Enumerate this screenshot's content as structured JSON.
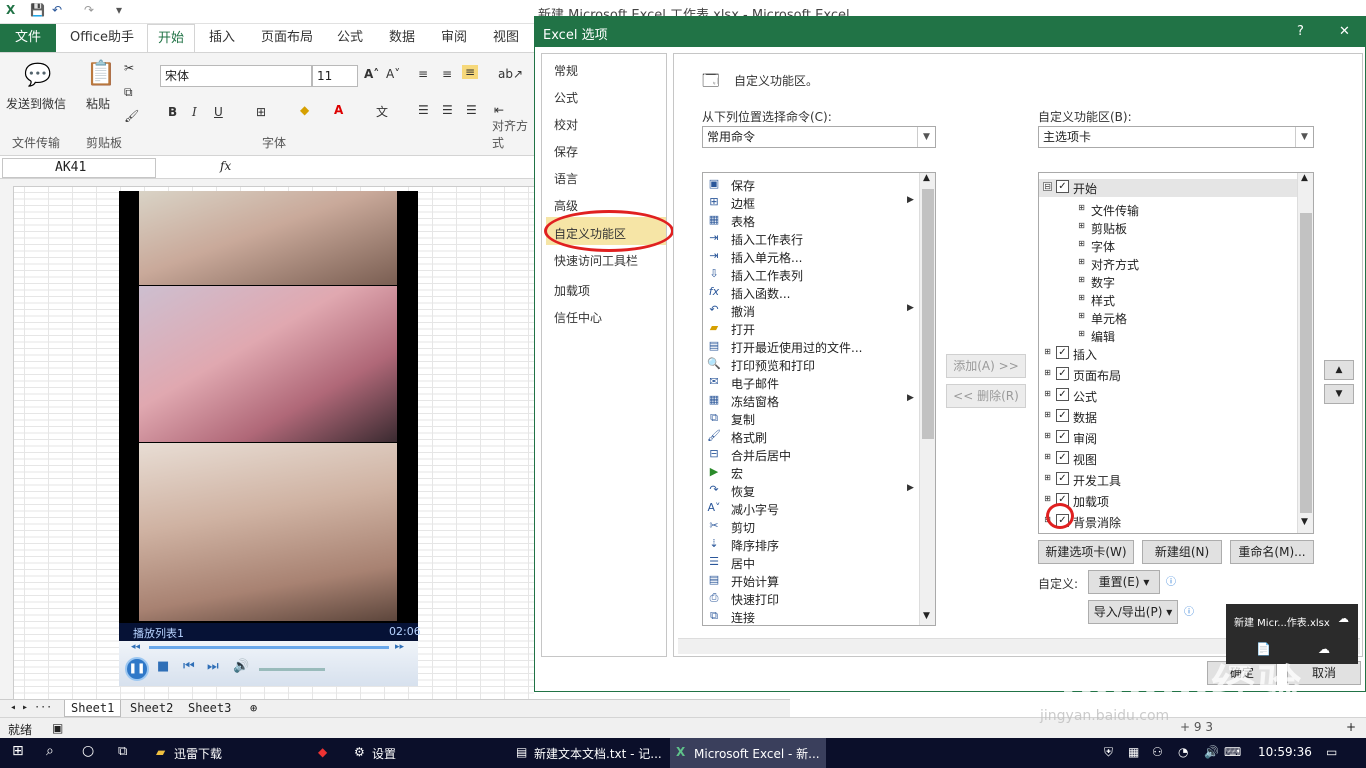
{
  "excel": {
    "title": "新建 Microsoft Excel 工作表.xlsx - Microsoft Excel",
    "tabs": [
      "文件",
      "Office助手",
      "开始",
      "插入",
      "页面布局",
      "公式",
      "数据",
      "审阅",
      "视图"
    ],
    "ribbon": {
      "send_wechat": "发送到微信",
      "paste": "粘贴",
      "font_name": "宋体",
      "font_size": "11",
      "bold": "B",
      "italic": "I",
      "underline": "U",
      "groups": [
        "文件传输",
        "剪贴板",
        "字体",
        "对齐方式"
      ]
    },
    "namebox": "AK41",
    "fx": "fx",
    "sheets": [
      "Sheet1",
      "Sheet2",
      "Sheet3"
    ],
    "status": "就绪",
    "zoom": "+",
    "time_fragment": "+ 9 3"
  },
  "player": {
    "playlist": "播放列表1",
    "time": "02:06"
  },
  "dialog": {
    "title": "Excel 选项",
    "help": "?",
    "close": "✕",
    "nav": [
      "常规",
      "公式",
      "校对",
      "保存",
      "语言",
      "高级",
      "自定义功能区",
      "快速访问工具栏",
      "加载项",
      "信任中心"
    ],
    "heading": "自定义功能区。",
    "choose_label": "从下列位置选择命令(C):",
    "choose_value": "常用命令",
    "customize_label": "自定义功能区(B):",
    "customize_value": "主选项卡",
    "commands": [
      "保存",
      "边框",
      "表格",
      "插入工作表行",
      "插入单元格...",
      "插入工作表列",
      "插入函数...",
      "撤消",
      "打开",
      "打开最近使用过的文件...",
      "打印预览和打印",
      "电子邮件",
      "冻结窗格",
      "复制",
      "格式刷",
      "合并后居中",
      "宏",
      "恢复",
      "减小字号",
      "剪切",
      "降序排序",
      "居中",
      "开始计算",
      "快速打印",
      "连接"
    ],
    "add": "添加(A) >>",
    "remove": "<< 删除(R)",
    "tree": [
      {
        "label": "开始",
        "level": 0,
        "exp": "⊟",
        "checked": true
      },
      {
        "label": "文件传输",
        "level": 1,
        "exp": "⊞",
        "checked": false
      },
      {
        "label": "剪贴板",
        "level": 1,
        "exp": "⊞",
        "checked": false
      },
      {
        "label": "字体",
        "level": 1,
        "exp": "⊞",
        "checked": false
      },
      {
        "label": "对齐方式",
        "level": 1,
        "exp": "⊞",
        "checked": false
      },
      {
        "label": "数字",
        "level": 1,
        "exp": "⊞",
        "checked": false
      },
      {
        "label": "样式",
        "level": 1,
        "exp": "⊞",
        "checked": false
      },
      {
        "label": "单元格",
        "level": 1,
        "exp": "⊞",
        "checked": false
      },
      {
        "label": "编辑",
        "level": 1,
        "exp": "⊞",
        "checked": false
      },
      {
        "label": "插入",
        "level": 0,
        "exp": "⊞",
        "checked": true
      },
      {
        "label": "页面布局",
        "level": 0,
        "exp": "⊞",
        "checked": true
      },
      {
        "label": "公式",
        "level": 0,
        "exp": "⊞",
        "checked": true
      },
      {
        "label": "数据",
        "level": 0,
        "exp": "⊞",
        "checked": true
      },
      {
        "label": "审阅",
        "level": 0,
        "exp": "⊞",
        "checked": true
      },
      {
        "label": "视图",
        "level": 0,
        "exp": "⊞",
        "checked": true
      },
      {
        "label": "开发工具",
        "level": 0,
        "exp": "⊞",
        "checked": true
      },
      {
        "label": "加载项",
        "level": 0,
        "exp": "⊞",
        "checked": true
      },
      {
        "label": "背景消除",
        "level": 0,
        "exp": "⊞",
        "checked": true
      }
    ],
    "new_tab": "新建选项卡(W)",
    "new_group": "新建组(N)",
    "rename": "重命名(M)...",
    "custom_label": "自定义:",
    "reset": "重置(E) ▾",
    "import_export": "导入/导出(P) ▾",
    "ok": "确定",
    "cancel": "取消"
  },
  "toast": {
    "title": "新建 Micr...作表.xlsx"
  },
  "taskbar": {
    "items": [
      "迅雷下载",
      "设置",
      "新建文本文档.txt - 记...",
      "Microsoft Excel - 新..."
    ],
    "clock": "10:59:36"
  },
  "watermark": {
    "brand": "Baidu经验",
    "url": "jingyan.baidu.com"
  },
  "colors": {
    "excel_green": "#217346",
    "highlight": "#f6e5a6",
    "annotation": "#e02020"
  }
}
